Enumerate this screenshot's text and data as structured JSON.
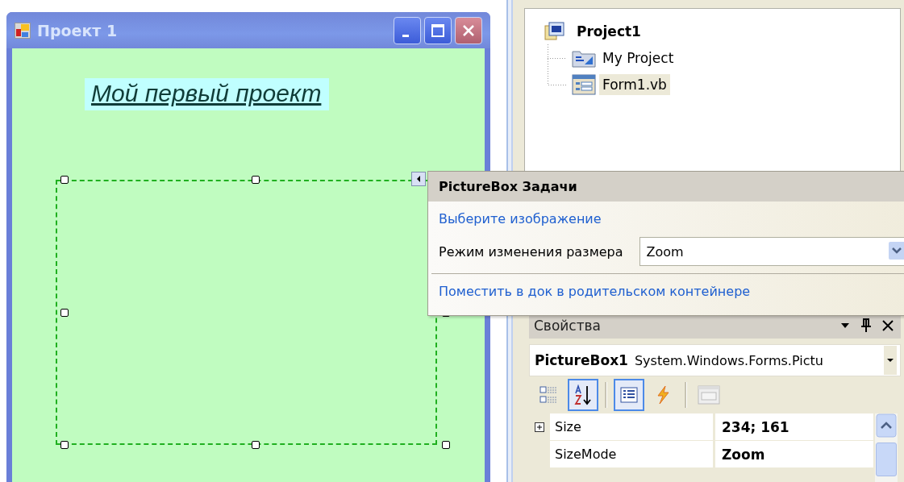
{
  "form_window": {
    "title": "Проект 1",
    "label": "Мой первый проект",
    "picturebox": {
      "selected": true
    }
  },
  "solution_explorer": {
    "items": [
      {
        "label": "Project1",
        "selected": false,
        "children": [
          {
            "label": "My Project",
            "kind": "project",
            "selected": false
          },
          {
            "label": "Form1.vb",
            "kind": "form",
            "selected": true
          }
        ]
      }
    ]
  },
  "smart_tag": {
    "title": "PictureBox Задачи",
    "links": [
      "Выберите изображение",
      "Поместить в док в родительском контейнере"
    ],
    "size_mode": {
      "label": "Режим изменения размера",
      "value": "Zoom"
    }
  },
  "properties": {
    "title": "Свойства",
    "object_name": "PictureBox1",
    "object_type": "System.Windows.Forms.Pictu",
    "toolbar": [
      {
        "kind": "categorized",
        "selected": false
      },
      {
        "kind": "alphabetical",
        "selected": true
      },
      {
        "kind": "properties",
        "selected": true
      },
      {
        "kind": "events",
        "selected": false
      },
      {
        "kind": "pages",
        "selected": false
      }
    ],
    "rows": [
      {
        "name": "Size",
        "value": "234; 161",
        "expandable": true
      },
      {
        "name": "SizeMode",
        "value": "Zoom",
        "expandable": false
      }
    ]
  }
}
